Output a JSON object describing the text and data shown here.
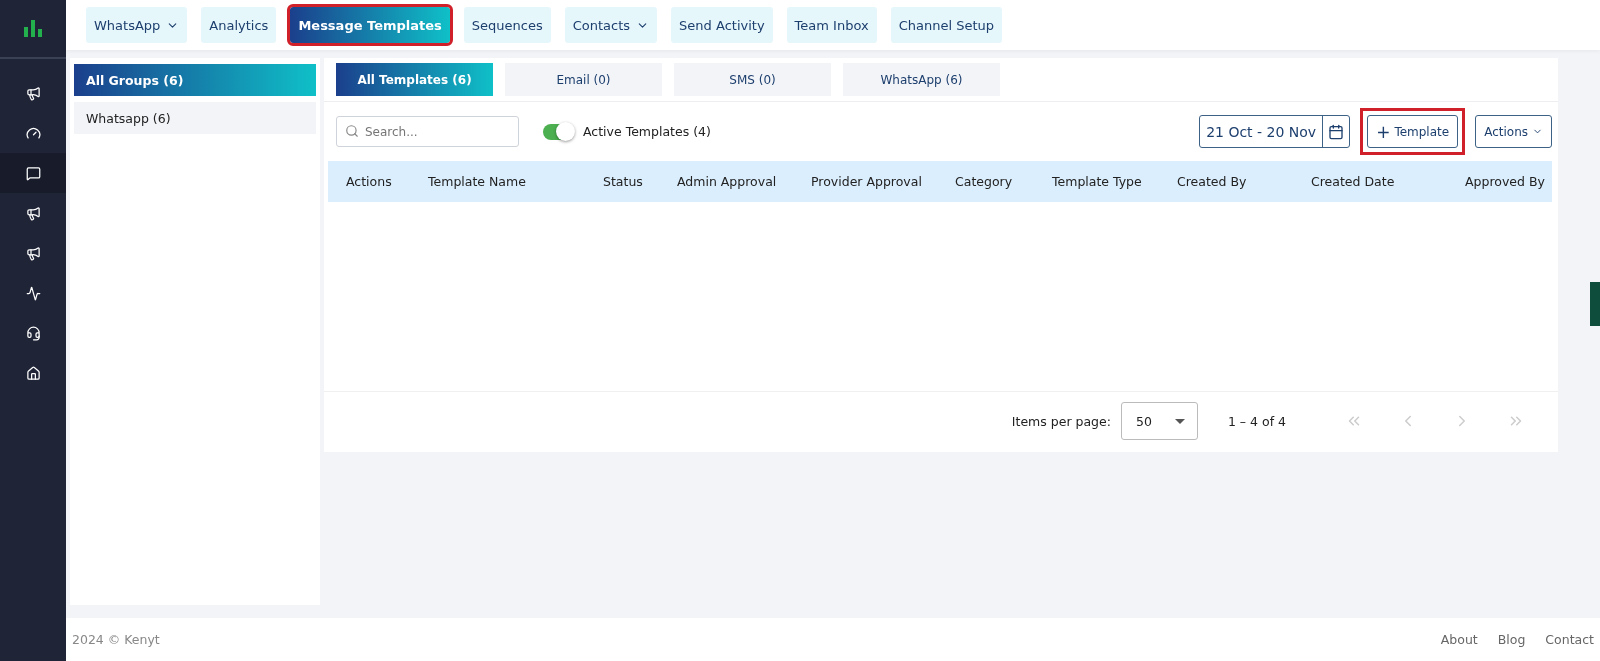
{
  "sidebar": {
    "items": [
      {
        "kind": "megaphone",
        "selected": false
      },
      {
        "kind": "gauge",
        "selected": false
      },
      {
        "kind": "chat",
        "selected": true
      },
      {
        "kind": "megaphone",
        "selected": false
      },
      {
        "kind": "megaphone",
        "selected": false
      },
      {
        "kind": "chart",
        "selected": false
      },
      {
        "kind": "headset",
        "selected": false
      },
      {
        "kind": "home",
        "selected": false
      }
    ]
  },
  "nav": [
    {
      "label": "WhatsApp",
      "dropdown": true,
      "selected": false,
      "highlighted": false
    },
    {
      "label": "Analytics",
      "dropdown": false,
      "selected": false,
      "highlighted": false
    },
    {
      "label": "Message Templates",
      "dropdown": false,
      "selected": true,
      "highlighted": true
    },
    {
      "label": "Sequences",
      "dropdown": false,
      "selected": false,
      "highlighted": false
    },
    {
      "label": "Contacts",
      "dropdown": true,
      "selected": false,
      "highlighted": false
    },
    {
      "label": "Send Activity",
      "dropdown": false,
      "selected": false,
      "highlighted": false
    },
    {
      "label": "Team Inbox",
      "dropdown": false,
      "selected": false,
      "highlighted": false
    },
    {
      "label": "Channel Setup",
      "dropdown": false,
      "selected": false,
      "highlighted": false
    }
  ],
  "groups": [
    {
      "label": "All Groups (6)",
      "selected": true
    },
    {
      "label": "Whatsapp (6)",
      "selected": false
    }
  ],
  "tabs": [
    {
      "label": "All Templates (6)",
      "selected": true
    },
    {
      "label": "Email (0)",
      "selected": false
    },
    {
      "label": "SMS (0)",
      "selected": false
    },
    {
      "label": "WhatsApp (6)",
      "selected": false
    }
  ],
  "search": {
    "placeholder": "Search..."
  },
  "active_toggle": {
    "label": "Active Templates (4)",
    "on": true
  },
  "date_range": "21 Oct - 20 Nov",
  "add_button": {
    "icon": "+",
    "label": "Template",
    "highlighted": true
  },
  "actions_button": "Actions",
  "table": {
    "columns": [
      "Actions",
      "Template Name",
      "Status",
      "Admin Approval",
      "Provider Approval",
      "Category",
      "Template Type",
      "Created By",
      "Created Date",
      "Approved By"
    ]
  },
  "pagination": {
    "items_label": "Items per page:",
    "page_size": "50",
    "range": "1 – 4 of 4"
  },
  "footer": {
    "copyright": "2024 © Kenyt",
    "links": [
      "About",
      "Blog",
      "Contact"
    ]
  }
}
